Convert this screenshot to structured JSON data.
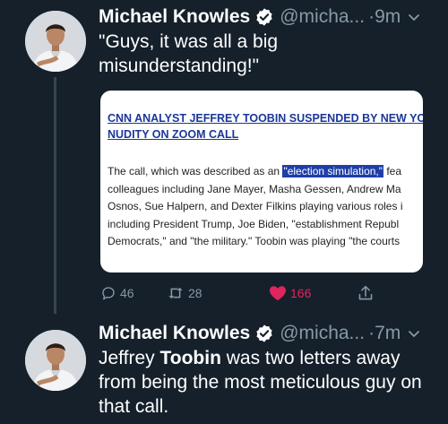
{
  "tweets": [
    {
      "author": "Michael Knowles",
      "handle": "@micha...",
      "separator": "·",
      "time": "9m",
      "text": "\"Guys, it was all a big misunderstanding!\"",
      "card": {
        "headline_line1": "CNN ANALYST JEFFREY TOOBIN SUSPENDED BY NEW YOR",
        "headline_line2": "NUDITY ON ZOOM CALL",
        "body": {
          "l1_pre": "The call, which was described as an ",
          "l1_highlight": "\"election simulation,\"",
          "l1_post": " fea",
          "l2": "colleagues including Jane Mayer, Masha Gessen, Andrew Ma",
          "l3": "Osnos, Sue Halpern, and Dexter Filkins playing various roles i",
          "l4": "including President Trump, Joe Biden, \"establishment Republ",
          "l5": "Democrats,\" and \"the military.\" Toobin was playing \"the courts"
        }
      },
      "actions": {
        "replies": "46",
        "retweets": "28",
        "likes": "166"
      }
    },
    {
      "author": "Michael Knowles",
      "handle": "@micha...",
      "separator": "·",
      "time": "7m",
      "text_pre": "Jeffrey ",
      "text_bold": "Toobin",
      "text_post": " was two letters away from being the most meticulous guy on that call."
    }
  ],
  "colors": {
    "background": "#15202b",
    "secondary_text": "#8899a6",
    "verified_badge": "#ffffff",
    "like_red": "#e0245e",
    "card_headline": "#1a3799",
    "highlight": "#1e3fa8"
  }
}
